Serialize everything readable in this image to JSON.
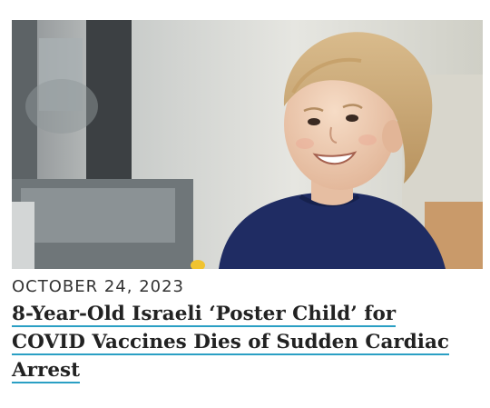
{
  "article": {
    "image": {
      "subject": "smiling-child-photo"
    },
    "date": "OCTOBER 24, 2023",
    "headline": "8-Year-Old Israeli ‘Poster Child’ for COVID Vaccines Dies of Sudden Cardiac Arrest",
    "link_color": "#2a9fc4"
  }
}
